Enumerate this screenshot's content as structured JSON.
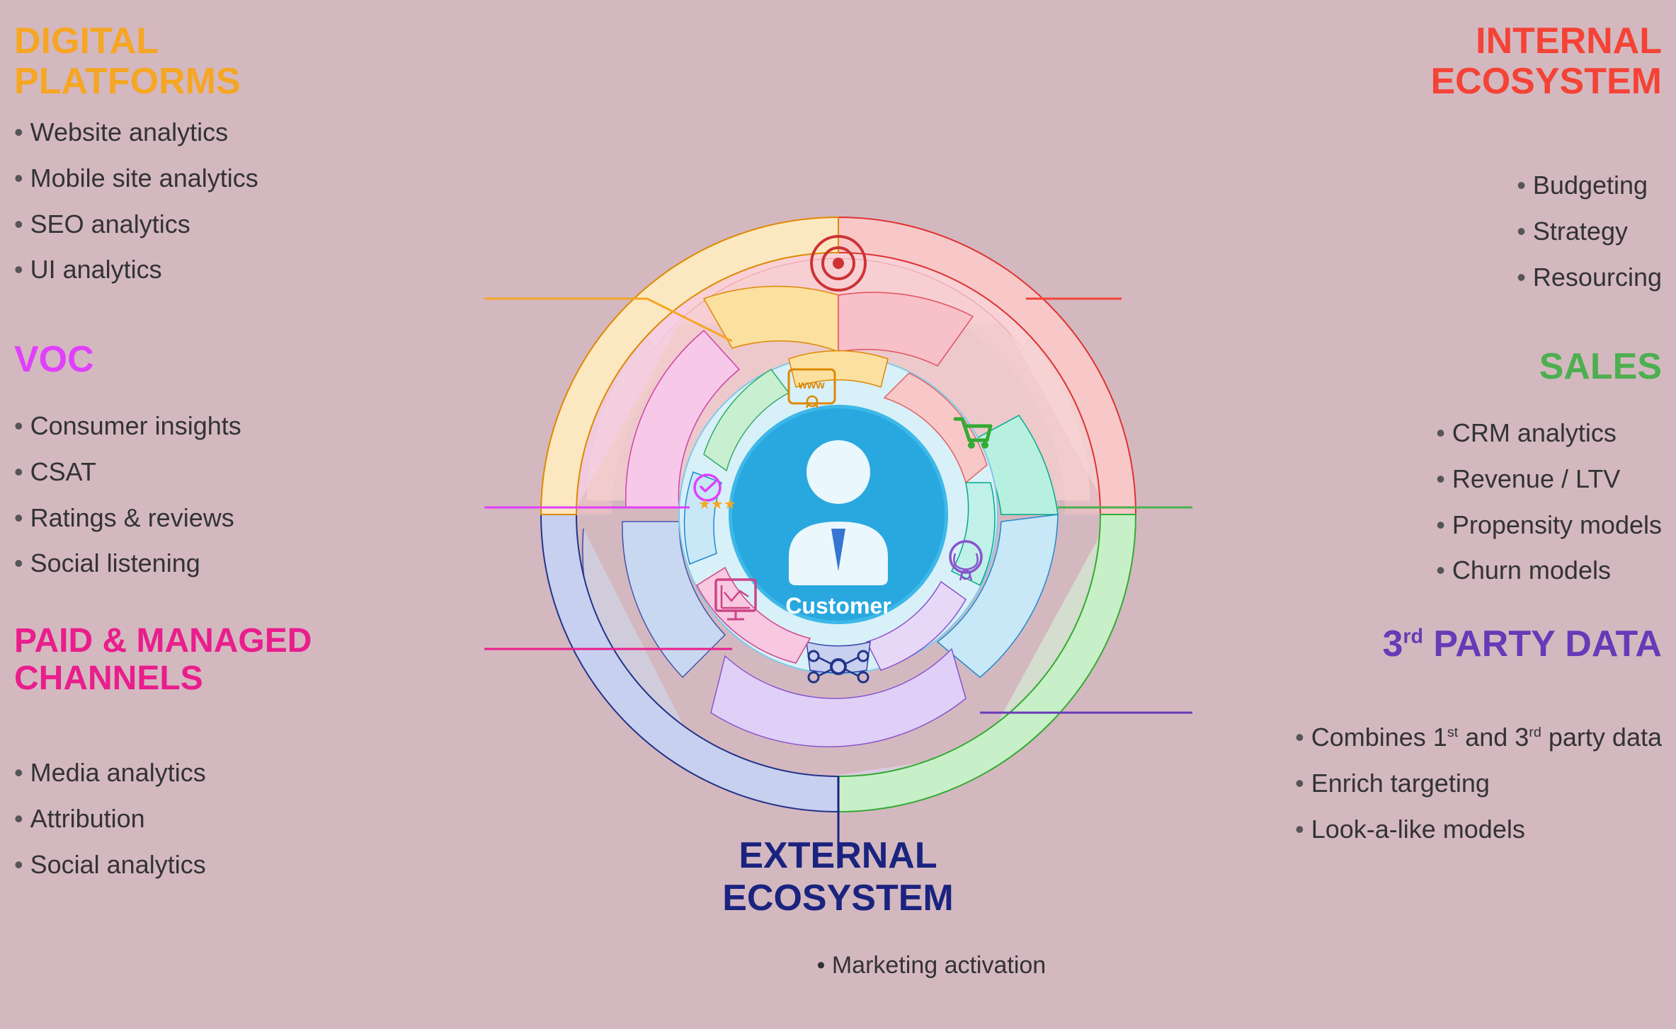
{
  "sections": {
    "digital_platforms": {
      "label": "DIGITAL\nPLATFORMS",
      "color": "#f5a623",
      "items": [
        "Website analytics",
        "Mobile site analytics",
        "SEO analytics",
        "UI analytics"
      ]
    },
    "voc": {
      "label": "VOC",
      "color": "#e040fb",
      "items": [
        "Consumer insights",
        "CSAT",
        "Ratings & reviews",
        "Social listening"
      ]
    },
    "paid_managed": {
      "label": "PAID & MANAGED\nCHANNELS",
      "color": "#e91e8c",
      "items": [
        "Media analytics",
        "Attribution",
        "Social analytics"
      ]
    },
    "internal_ecosystem": {
      "label": "INTERNAL\nECOSYSTEM",
      "color": "#f44336",
      "items": [
        "Budgeting",
        "Strategy",
        "Resourcing"
      ]
    },
    "sales": {
      "label": "SALES",
      "color": "#4caf50",
      "items": [
        "CRM analytics",
        "Revenue / LTV",
        "Propensity models",
        "Churn models"
      ]
    },
    "party_data": {
      "label_line1": "3",
      "label_sup": "rd",
      "label_line2": " PARTY DATA",
      "color": "#673ab7",
      "items": [
        "Combines 1st and 3rd party data",
        "Enrich targeting",
        "Look-a-like models"
      ]
    },
    "external_ecosystem": {
      "label": "EXTERNAL\nECOSYSTEM",
      "color": "#1a237e",
      "items": [
        "Marketing activation"
      ]
    },
    "center": {
      "label": "Customer"
    }
  }
}
